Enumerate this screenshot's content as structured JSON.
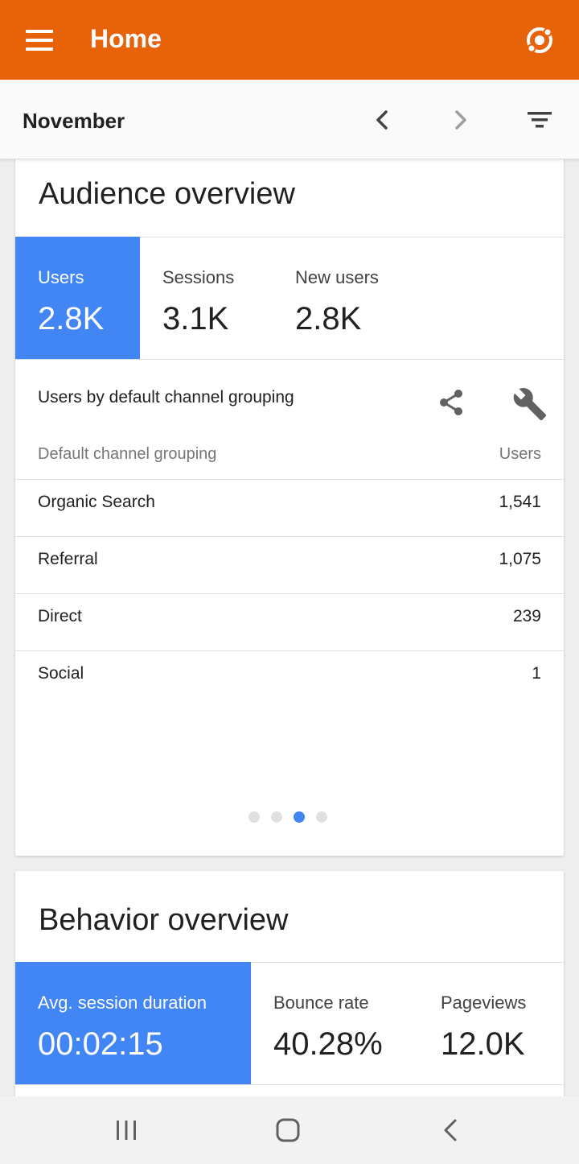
{
  "appbar": {
    "title": "Home"
  },
  "datebar": {
    "month": "November"
  },
  "audience": {
    "title": "Audience overview",
    "metrics": [
      {
        "label": "Users",
        "value": "2.8K",
        "active": true
      },
      {
        "label": "Sessions",
        "value": "3.1K",
        "active": false
      },
      {
        "label": "New users",
        "value": "2.8K",
        "active": false
      }
    ],
    "table": {
      "title": "Users by default channel grouping",
      "col_left": "Default channel grouping",
      "col_right": "Users",
      "rows": [
        {
          "name": "Organic Search",
          "value": "1,541"
        },
        {
          "name": "Referral",
          "value": "1,075"
        },
        {
          "name": "Direct",
          "value": "239"
        },
        {
          "name": "Social",
          "value": "1"
        }
      ]
    },
    "pager": {
      "count": 4,
      "active_index": 2
    }
  },
  "behavior": {
    "title": "Behavior overview",
    "metrics": [
      {
        "label": "Avg. session duration",
        "value": "00:02:15",
        "active": true
      },
      {
        "label": "Bounce rate",
        "value": "40.28%",
        "active": false
      },
      {
        "label": "Pageviews",
        "value": "12.0K",
        "active": false
      }
    ]
  },
  "colors": {
    "appbar": "#e8620a",
    "accent": "#4285f4"
  },
  "icons": {
    "menu": "menu-icon",
    "account": "account-switch-icon",
    "prev": "chevron-left-icon",
    "next": "chevron-right-icon",
    "filter": "filter-icon",
    "share": "share-icon",
    "wrench": "wrench-icon"
  }
}
